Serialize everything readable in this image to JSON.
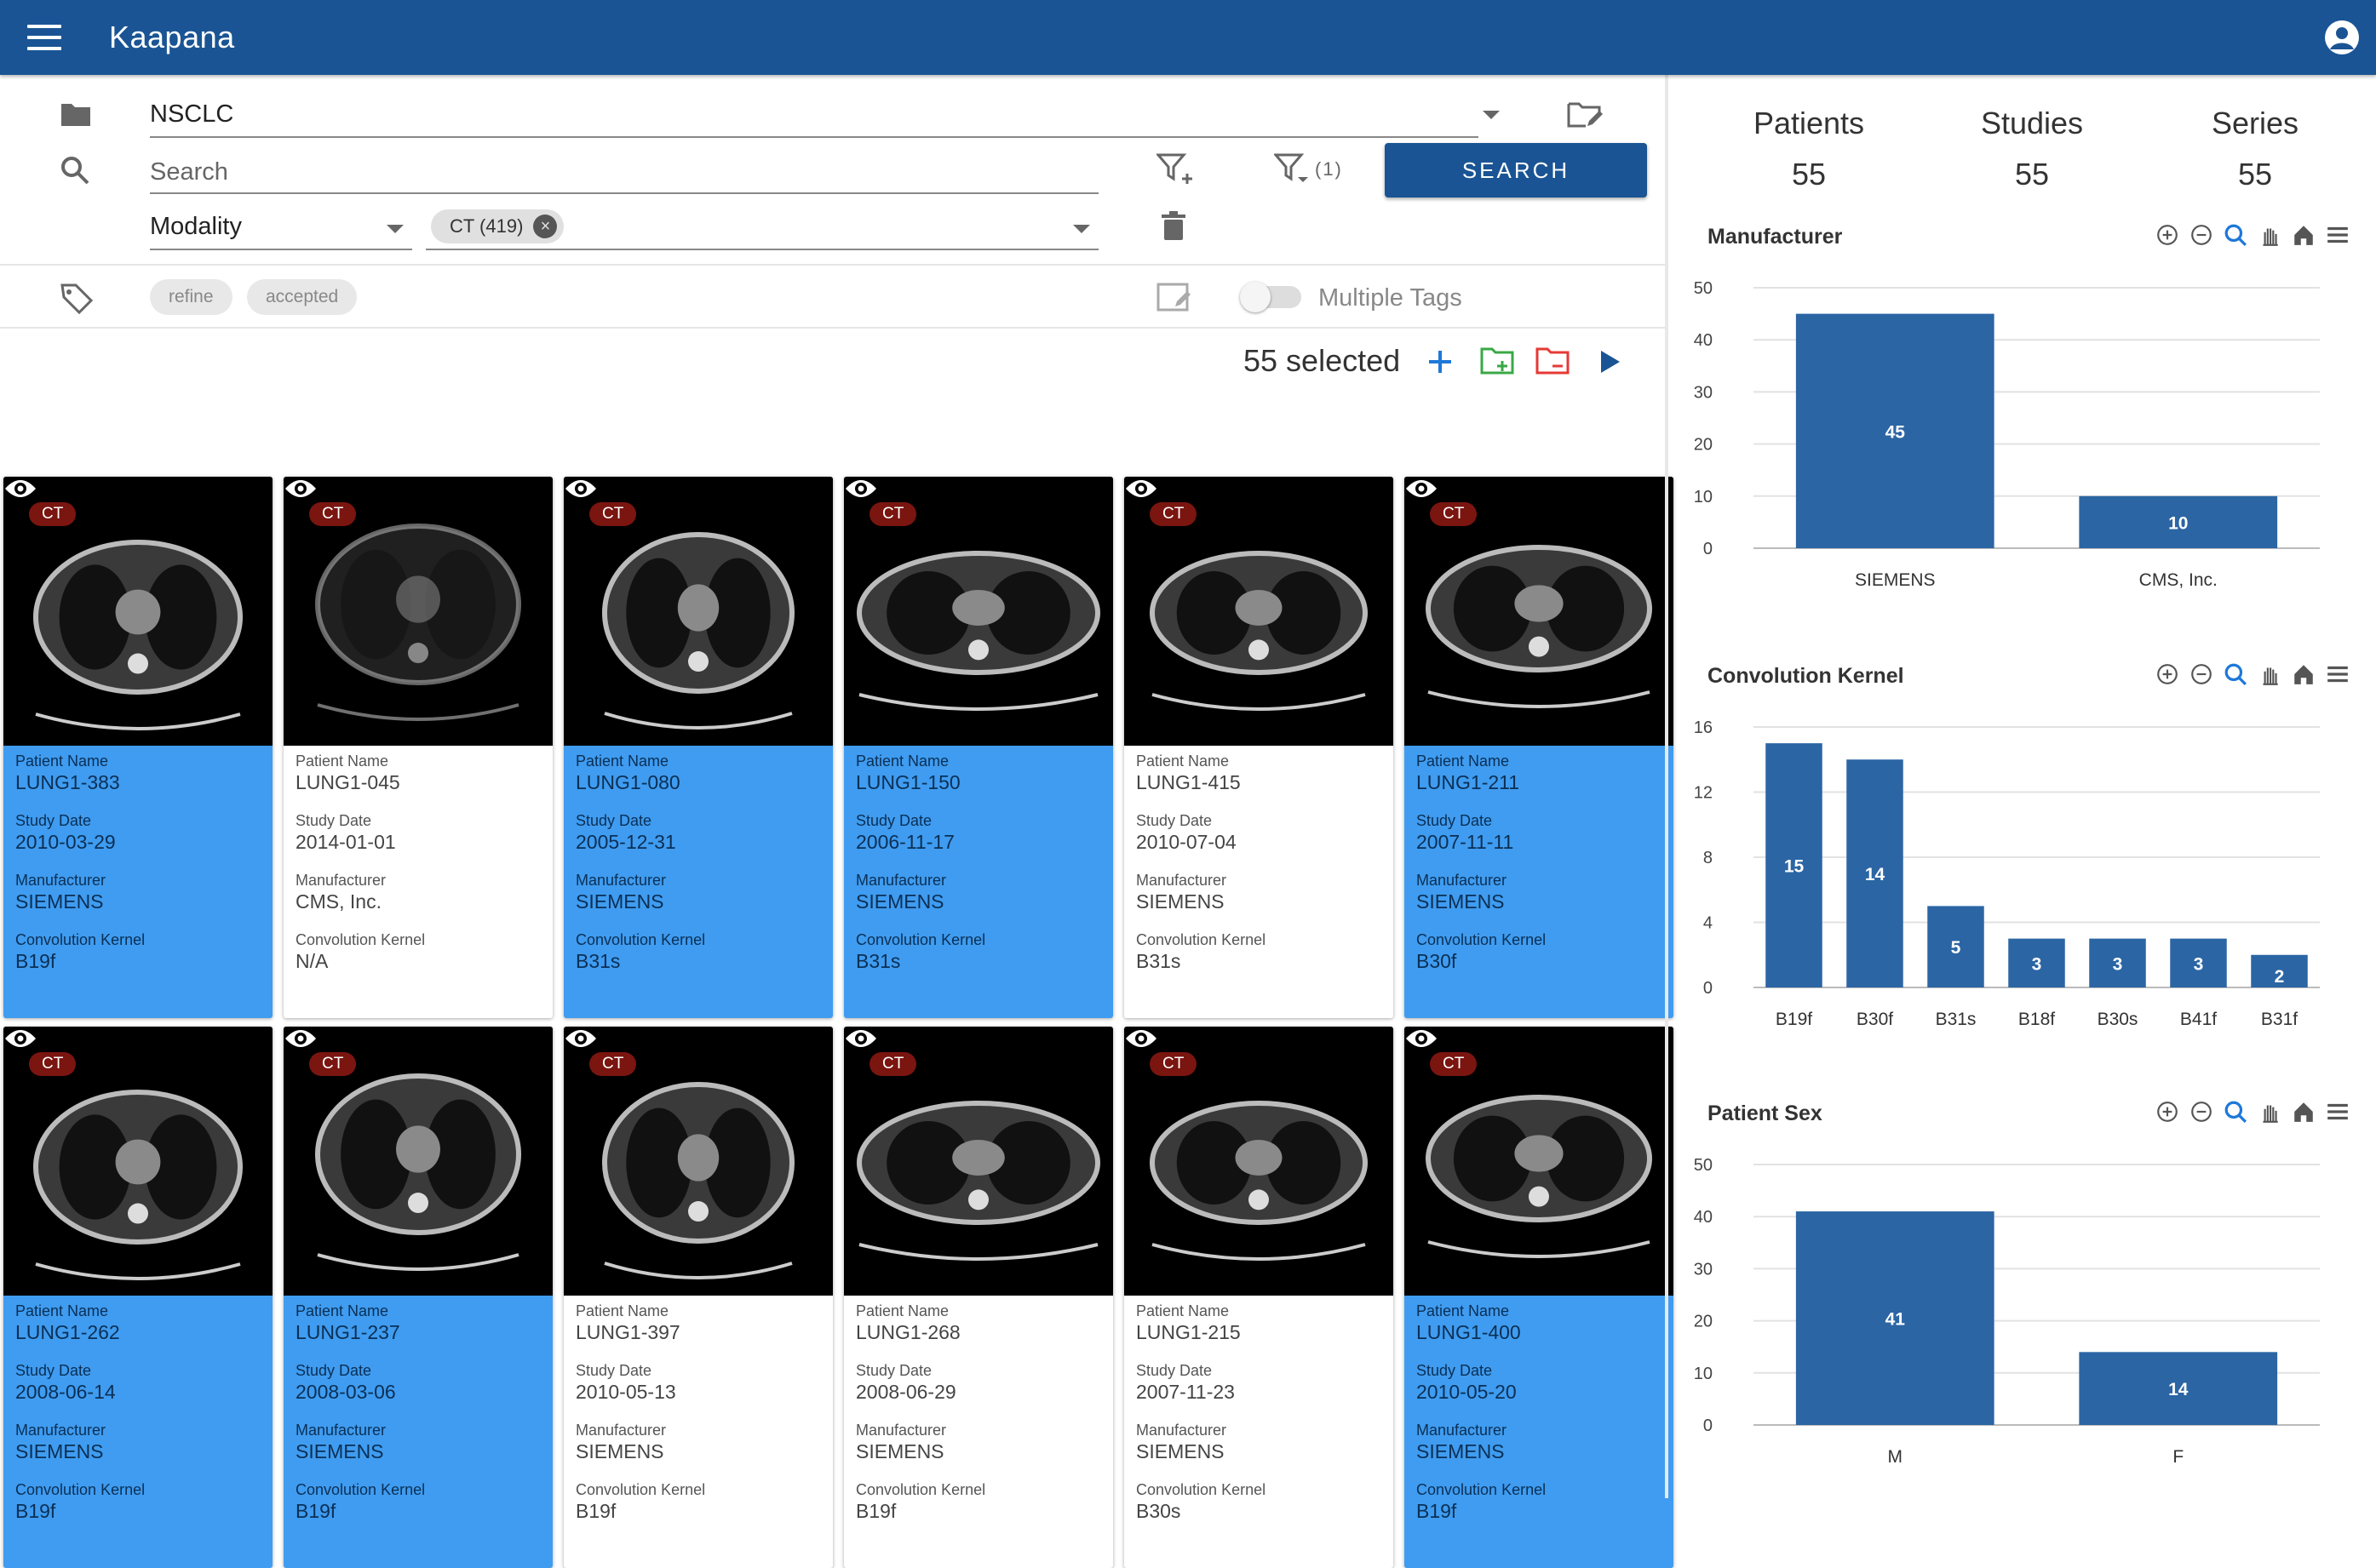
{
  "app": {
    "title": "Kaapana"
  },
  "filters": {
    "collection": "NSCLC",
    "search_placeholder": "Search",
    "modality_label": "Modality",
    "modality_chip": "CT (419)",
    "filter_count": "(1)",
    "search_button": "SEARCH",
    "tags": [
      "refine",
      "accepted"
    ],
    "multiple_tags_label": "Multiple Tags"
  },
  "selection": {
    "text": "55 selected"
  },
  "colors": {
    "appbar": "#1a5494",
    "selected_card": "#3f9cf0",
    "bar": "#2b65a4",
    "badge": "#7a1510"
  },
  "labels": {
    "patient_name": "Patient Name",
    "study_date": "Study Date",
    "manufacturer": "Manufacturer",
    "convolution_kernel": "Convolution Kernel",
    "modality_badge": "CT"
  },
  "cards": [
    {
      "patient": "LUNG1-383",
      "date": "2010-03-29",
      "manufacturer": "SIEMENS",
      "kernel": "B19f",
      "selected": true
    },
    {
      "patient": "LUNG1-045",
      "date": "2014-01-01",
      "manufacturer": "CMS, Inc.",
      "kernel": "N/A",
      "selected": false
    },
    {
      "patient": "LUNG1-080",
      "date": "2005-12-31",
      "manufacturer": "SIEMENS",
      "kernel": "B31s",
      "selected": true
    },
    {
      "patient": "LUNG1-150",
      "date": "2006-11-17",
      "manufacturer": "SIEMENS",
      "kernel": "B31s",
      "selected": true
    },
    {
      "patient": "LUNG1-415",
      "date": "2010-07-04",
      "manufacturer": "SIEMENS",
      "kernel": "B31s",
      "selected": false
    },
    {
      "patient": "LUNG1-211",
      "date": "2007-11-11",
      "manufacturer": "SIEMENS",
      "kernel": "B30f",
      "selected": true
    },
    {
      "patient": "LUNG1-262",
      "date": "2008-06-14",
      "manufacturer": "SIEMENS",
      "kernel": "B19f",
      "selected": true
    },
    {
      "patient": "LUNG1-237",
      "date": "2008-03-06",
      "manufacturer": "SIEMENS",
      "kernel": "B19f",
      "selected": true
    },
    {
      "patient": "LUNG1-397",
      "date": "2010-05-13",
      "manufacturer": "SIEMENS",
      "kernel": "B19f",
      "selected": false
    },
    {
      "patient": "LUNG1-268",
      "date": "2008-06-29",
      "manufacturer": "SIEMENS",
      "kernel": "B19f",
      "selected": false
    },
    {
      "patient": "LUNG1-215",
      "date": "2007-11-23",
      "manufacturer": "SIEMENS",
      "kernel": "B30s",
      "selected": false
    },
    {
      "patient": "LUNG1-400",
      "date": "2010-05-20",
      "manufacturer": "SIEMENS",
      "kernel": "B19f",
      "selected": true
    }
  ],
  "stats": [
    {
      "label": "Patients",
      "value": "55"
    },
    {
      "label": "Studies",
      "value": "55"
    },
    {
      "label": "Series",
      "value": "55"
    }
  ],
  "chart_data": [
    {
      "type": "bar",
      "title": "Manufacturer",
      "categories": [
        "SIEMENS",
        "CMS, Inc."
      ],
      "values": [
        45,
        10
      ],
      "ylim": [
        0,
        50
      ],
      "yticks": [
        0,
        10,
        20,
        30,
        40,
        50
      ],
      "grid": true
    },
    {
      "type": "bar",
      "title": "Convolution Kernel",
      "categories": [
        "B19f",
        "B30f",
        "B31s",
        "B18f",
        "B30s",
        "B41f",
        "B31f"
      ],
      "values": [
        15,
        14,
        5,
        3,
        3,
        3,
        2
      ],
      "ylim": [
        0,
        16
      ],
      "yticks": [
        0,
        4,
        8,
        12,
        16
      ],
      "grid": true
    },
    {
      "type": "bar",
      "title": "Patient Sex",
      "categories": [
        "M",
        "F"
      ],
      "values": [
        41,
        14
      ],
      "ylim": [
        0,
        50
      ],
      "yticks": [
        0,
        10,
        20,
        30,
        40,
        50
      ],
      "grid": true
    }
  ]
}
